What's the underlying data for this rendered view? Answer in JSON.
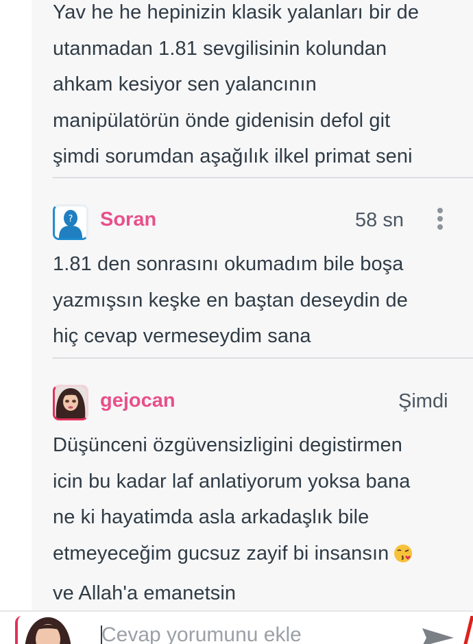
{
  "comments": [
    {
      "text_lines": [
        "Yav he he hepinizin klasik yalanları bir de",
        "utanmadan 1.81 sevgilisinin kolundan",
        "ahkam kesiyor sen yalancının",
        "manipülatörün önde gidenisin defol git",
        "şimdi sorumdan aşağılık ilkel primat seni"
      ]
    },
    {
      "username": "Soran",
      "time": "58 sn",
      "avatar_icon": "anonymous-user-icon",
      "menu_icon": "more-vertical-icon",
      "text_lines": [
        "1.81 den sonrasını okumadım bile boşa",
        "yazmışsın keşke en baştan deseydin de",
        "hiç cevap vermeseydim sana"
      ]
    },
    {
      "username": "gejocan",
      "time": "Şimdi",
      "avatar_icon": "doll-avatar",
      "text_lines": [
        "Düşünceni özgüvensizligini degistirmen",
        "icin bu kadar laf anlatiyorum yoksa bana",
        "ne ki hayatimda asla arkadaşlık bile",
        "etmeyeceğim gucsuz zayif bi insansın",
        "ve Allah'a emanetsin"
      ],
      "emoji": "kissing-face-emoji"
    }
  ],
  "reply_bar": {
    "placeholder": "Cevap yorumunu ekle",
    "avatar_icon": "doll-avatar",
    "send_icon": "send-icon"
  },
  "colors": {
    "username": "#e8508a",
    "body_text": "#2f3b45",
    "thread_background": "#f7f7f8",
    "divider": "#dcdde0"
  }
}
